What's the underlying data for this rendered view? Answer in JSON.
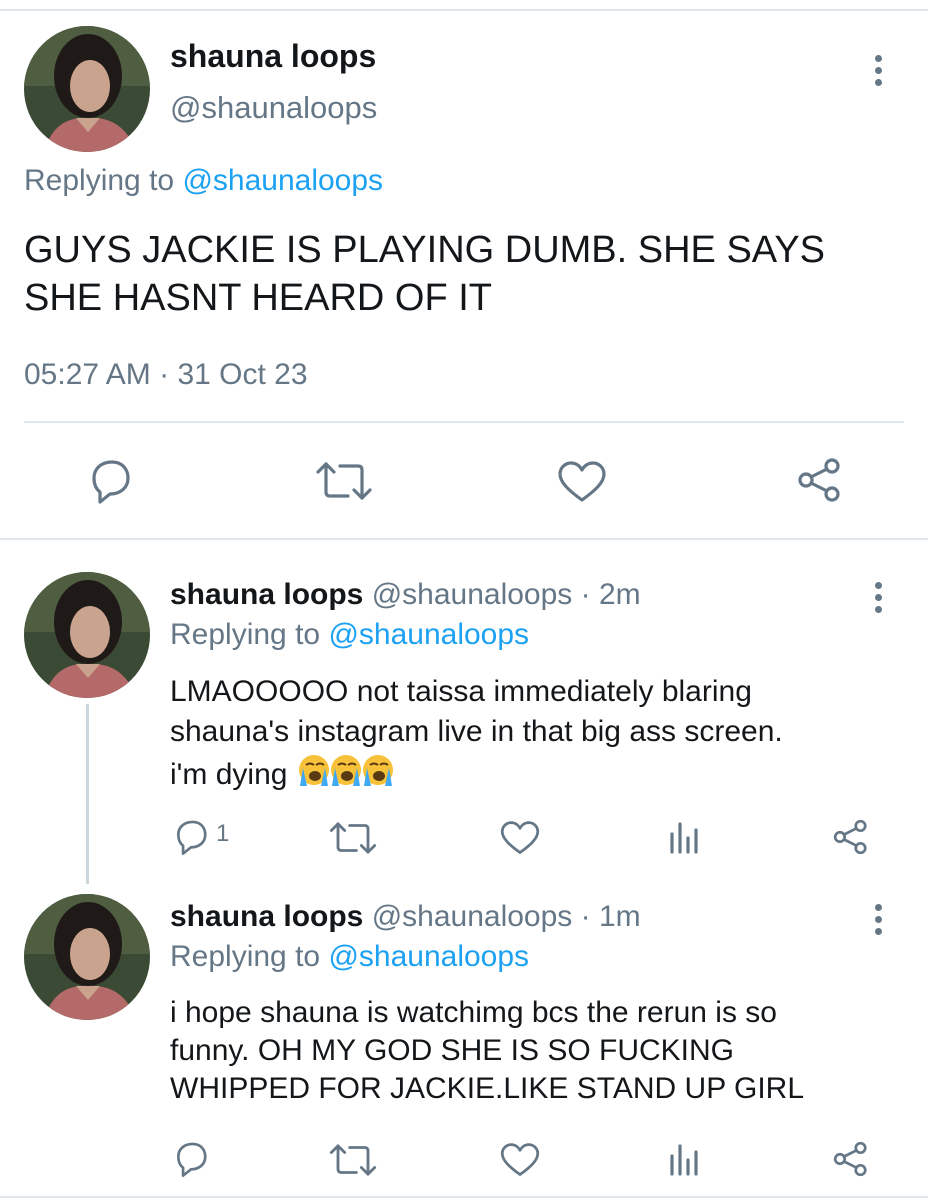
{
  "main_tweet": {
    "display_name": "shauna loops",
    "handle": "@shaunaloops",
    "replying_prefix": "Replying to",
    "replying_to": "@shaunaloops",
    "text_line1": "GUYS JACKIE IS PLAYING DUMB. SHE SAYS",
    "text_line2": "SHE HASNT HEARD OF IT",
    "time": "05:27 AM",
    "separator": "·",
    "date": "31 Oct 23"
  },
  "replies": [
    {
      "display_name": "shauna loops",
      "handle": "@shaunaloops",
      "age": "· 2m",
      "replying_prefix": "Replying to",
      "replying_to": "@shaunaloops",
      "line1": "LMAOOOOO not taissa immediately blaring",
      "line2": "shauna's instagram live in that big ass screen.",
      "line3": "i'm dying",
      "emoji": "loudly-crying-face x3",
      "reply_count": "1"
    },
    {
      "display_name": "shauna loops",
      "handle": "@shaunaloops",
      "age": "· 1m",
      "replying_prefix": "Replying to",
      "replying_to": "@shaunaloops",
      "line1": "i hope shauna is watchimg bcs the rerun is so",
      "line2": "funny. OH MY GOD SHE IS SO FUCKING",
      "line3": "WHIPPED FOR JACKIE.LIKE STAND UP GIRL",
      "reply_count": ""
    }
  ],
  "colors": {
    "link": "#1da1f2",
    "muted": "#657786",
    "text": "#14171a",
    "divider": "#e1e8ed"
  }
}
